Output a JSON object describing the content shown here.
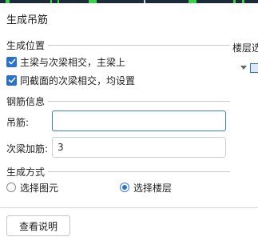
{
  "dialog": {
    "title": "生成吊筋"
  },
  "position_section": {
    "title": "生成位置",
    "options": [
      {
        "label": "主梁与次梁相交，主梁上",
        "checked": true
      },
      {
        "label": "同截面的次梁相交，均设置",
        "checked": true
      }
    ]
  },
  "rebar_section": {
    "title": "钢筋信息",
    "hanger_label": "吊筋:",
    "hanger_value": "",
    "secondary_label": "次梁加筋:",
    "secondary_value": "3"
  },
  "method_section": {
    "title": "生成方式",
    "options": [
      {
        "label": "选择图元",
        "selected": false
      },
      {
        "label": "选择楼层",
        "selected": true
      }
    ]
  },
  "footer": {
    "help_button": "查看说明"
  },
  "side_panel": {
    "title": "楼层选"
  },
  "colors": {
    "accent": "#2a72c9",
    "focus_border": "#3d7bd0",
    "rule": "#c9c9c9"
  },
  "icons": [
    "check-icon",
    "tree-expand-arrow-icon",
    "floor-tree-icon"
  ]
}
